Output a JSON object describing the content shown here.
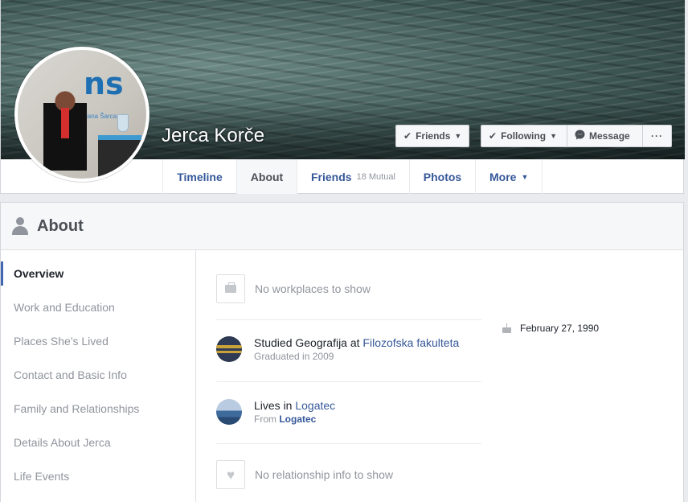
{
  "profile": {
    "name": "Jerca Korče"
  },
  "cover_actions": {
    "friends_label": "Friends",
    "following_label": "Following",
    "message_label": "Message",
    "more_label": "···"
  },
  "tabs": [
    {
      "label": "Timeline"
    },
    {
      "label": "About"
    },
    {
      "label": "Friends",
      "sub": "18 Mutual"
    },
    {
      "label": "Photos"
    },
    {
      "label": "More"
    }
  ],
  "about": {
    "title": "About",
    "nav": [
      {
        "label": "Overview",
        "active": true
      },
      {
        "label": "Work and Education"
      },
      {
        "label": "Places She's Lived"
      },
      {
        "label": "Contact and Basic Info"
      },
      {
        "label": "Family and Relationships"
      },
      {
        "label": "Details About Jerca"
      },
      {
        "label": "Life Events"
      }
    ],
    "overview": {
      "work_empty": "No workplaces to show",
      "education": {
        "prefix": "Studied Geografija at",
        "school": "Filozofska fakulteta",
        "sub": "Graduated in 2009"
      },
      "lives": {
        "prefix": "Lives in",
        "city": "Logatec",
        "from_prefix": "From",
        "from_city": "Logatec"
      },
      "relationship_empty": "No relationship info to show"
    },
    "birthday": "February 27, 1990"
  },
  "colors": {
    "link": "#365899",
    "active_nav_border": "#4267b2",
    "muted_text": "#90949c"
  },
  "icons": [
    "check-icon",
    "caret-down-icon",
    "messenger-icon",
    "ellipsis-icon",
    "person-icon",
    "briefcase-icon",
    "heart-icon",
    "cake-icon"
  ]
}
